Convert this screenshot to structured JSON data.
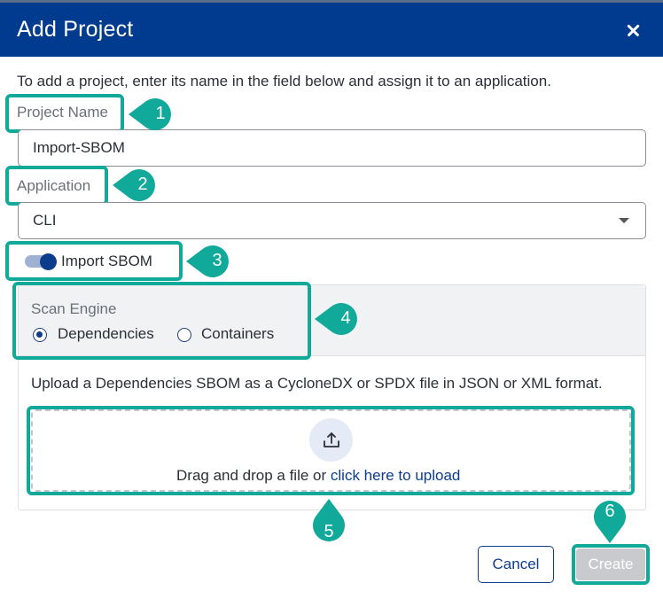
{
  "dialog": {
    "title": "Add Project",
    "intro": "To add a project, enter its name in the field below and assign it to an application."
  },
  "project_name": {
    "label": "Project Name",
    "value": "Import-SBOM"
  },
  "application": {
    "label": "Application",
    "value": "CLI"
  },
  "import_sbom": {
    "label": "Import SBOM",
    "enabled": true
  },
  "scan_engine": {
    "label": "Scan Engine",
    "options": [
      {
        "label": "Dependencies",
        "selected": true
      },
      {
        "label": "Containers",
        "selected": false
      }
    ]
  },
  "upload": {
    "instructions": "Upload a Dependencies SBOM as a CycloneDX or SPDX file in JSON or XML format.",
    "drop_text": "Drag and drop a file or ",
    "link_text": "click here to upload"
  },
  "buttons": {
    "cancel": "Cancel",
    "create": "Create"
  },
  "callouts": [
    "1",
    "2",
    "3",
    "4",
    "5",
    "6"
  ],
  "colors": {
    "header": "#003b8f",
    "accent": "#0c3d8c",
    "highlight": "#11a99a",
    "disabled_button": "#c8cace"
  }
}
